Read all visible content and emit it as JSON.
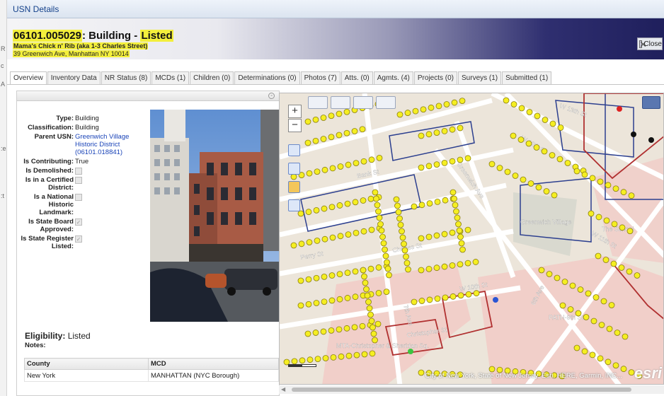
{
  "window": {
    "title": "USN Details"
  },
  "header": {
    "usn": "06101.005029",
    "sep": ": ",
    "type": "Building",
    "dash": " - ",
    "status": "Listed",
    "subtitle": "Mama's Chick n' Rib (aka 1-3 Charles Street)",
    "address": "39 Greenwich Ave, Manhattan NY 10014",
    "close_label": "Close"
  },
  "tabs": [
    "Overview",
    "Inventory Data",
    "NR Status (8)",
    "MCDs (1)",
    "Children (0)",
    "Determinations (0)",
    "Photos (7)",
    "Atts. (0)",
    "Agmts. (4)",
    "Projects (0)",
    "Surveys (1)",
    "Submitted (1)"
  ],
  "properties": {
    "type_label": "Type:",
    "type_value": "Building",
    "class_label": "Classification:",
    "class_value": "Building",
    "parent_label": "Parent USN:",
    "parent_value_1": "Greenwich Village",
    "parent_value_2": "Historic District",
    "parent_value_3": "(06101.018841)",
    "contrib_label": "Is Contributing:",
    "contrib_value": "True",
    "demolished_label": "Is Demolished:",
    "certified_label_1": "Is in a Certified",
    "certified_label_2": "District:",
    "landmark_label_1": "Is a National",
    "landmark_label_2": "Historic",
    "landmark_label_3": "Landmark:",
    "stateboard_label_1": "Is State Board",
    "stateboard_label_2": "Approved:",
    "register_label_1": "Is State Register",
    "register_label_2": "Listed:"
  },
  "eligibility": {
    "label": "Eligibility:",
    "value": "Listed",
    "notes_label": "Notes:"
  },
  "mcd_table": {
    "headers": [
      "County",
      "MCD"
    ],
    "rows": [
      [
        "New York",
        "MANHATTAN (NYC Borough)"
      ]
    ]
  },
  "map": {
    "streets": [
      "Bank St",
      "W 12th St",
      "W 11th St",
      "Perry St",
      "Charles St",
      "W 10th St",
      "Christopher St",
      "7th Ave",
      "Greenwich Ave",
      "6th Ave",
      "Greenwich Village",
      "MTA-Christopher & Sheridan Sq.",
      "PATH-9th St",
      "The School",
      "W 13th St"
    ],
    "attribution": "City of New York, State of New Jersey, Esri, HERE, Garmin, INC...",
    "logo": "esri"
  },
  "colors": {
    "highlight": "#f3ef3c",
    "link": "#1a44b8",
    "marker": "#f5ee22",
    "parcel": "#b03030"
  },
  "icons": [
    "close-icon",
    "collapse-icon",
    "zoom-in-icon",
    "zoom-out-icon",
    "zoom-extent-icon",
    "select-icon",
    "pan-icon",
    "identify-icon",
    "layers-icon",
    "legend-icon",
    "globe-icon",
    "measure-icon"
  ]
}
